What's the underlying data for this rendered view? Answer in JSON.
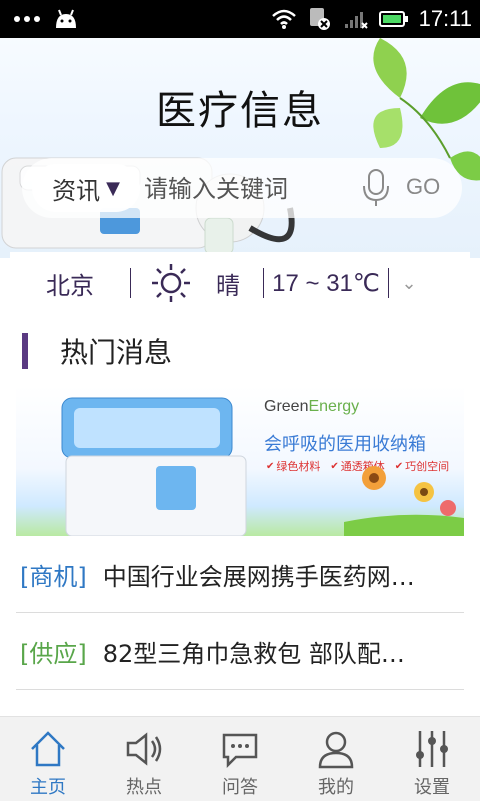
{
  "status_bar": {
    "time": "17:11"
  },
  "header": {
    "title": "医疗信息"
  },
  "search": {
    "type_label": "资讯",
    "placeholder": "请输入关键词",
    "go_label": "GO"
  },
  "weather": {
    "city": "北京",
    "condition": "晴",
    "temperature": "17 ~ 31℃"
  },
  "section": {
    "title": "热门消息"
  },
  "banner": {
    "brand_prefix": "Green",
    "brand_suffix": "Energy",
    "headline": "会呼吸的医用收纳箱",
    "tags": [
      "绿色材料",
      "通透箱体",
      "巧创空间"
    ]
  },
  "news": [
    {
      "tag": "[商机]",
      "title": "中国行业会展网携手医药网…"
    },
    {
      "tag": "[供应]",
      "title": "82型三角巾急救包 部队配…"
    }
  ],
  "tabbar": {
    "items": [
      {
        "label": "主页",
        "icon": "home-icon",
        "active": true
      },
      {
        "label": "热点",
        "icon": "speaker-icon",
        "active": false
      },
      {
        "label": "问答",
        "icon": "chat-icon",
        "active": false
      },
      {
        "label": "我的",
        "icon": "user-icon",
        "active": false
      },
      {
        "label": "设置",
        "icon": "sliders-icon",
        "active": false
      }
    ]
  },
  "colors": {
    "accent": "#2f78c4",
    "purple": "#5a3a82",
    "green_tag": "#59a64a"
  }
}
